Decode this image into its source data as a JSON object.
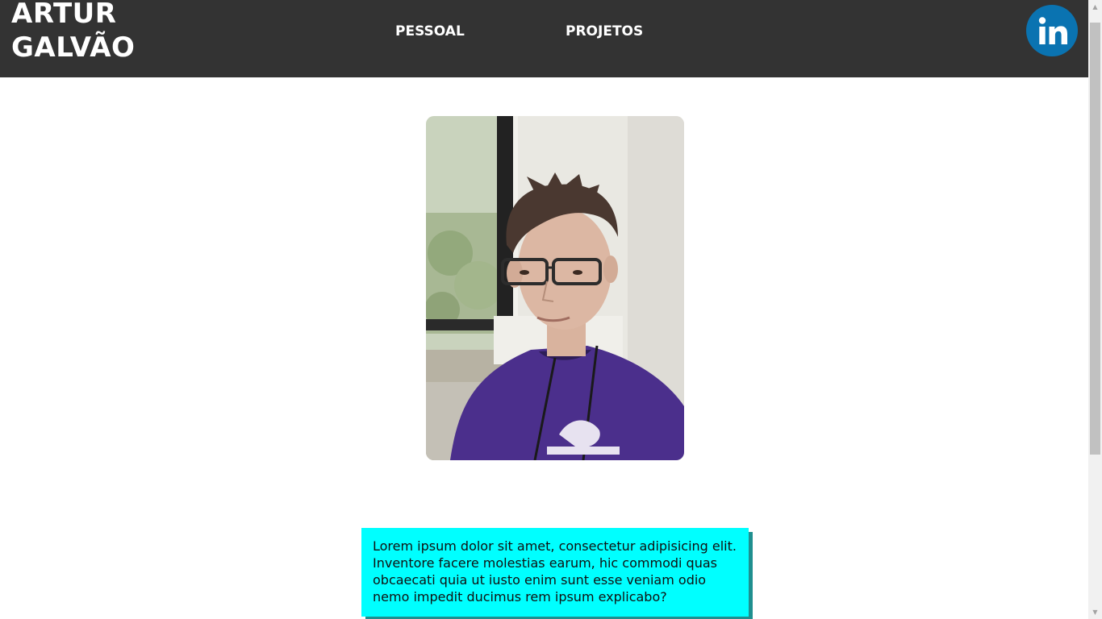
{
  "header": {
    "logo_line1": "ARTUR",
    "logo_line2": "GALVÃO",
    "nav": [
      {
        "label": "PESSOAL"
      },
      {
        "label": "PROJETOS"
      }
    ],
    "social_icon": "linkedin-icon",
    "social_label": "in"
  },
  "main": {
    "photo_icon": "profile-photo",
    "about_text": "Lorem ipsum dolor sit amet, consectetur adipisicing elit. Inventore facere molestias earum, hic commodi quas obcaecati quia ut iusto enim sunt esse veniam odio nemo impedit ducimus rem ipsum explicabo?"
  },
  "colors": {
    "header_bg": "#333333",
    "linkedin_blue": "#0a73b1",
    "card_bg": "#00ffff",
    "card_shadow": "#1f8f8f"
  }
}
